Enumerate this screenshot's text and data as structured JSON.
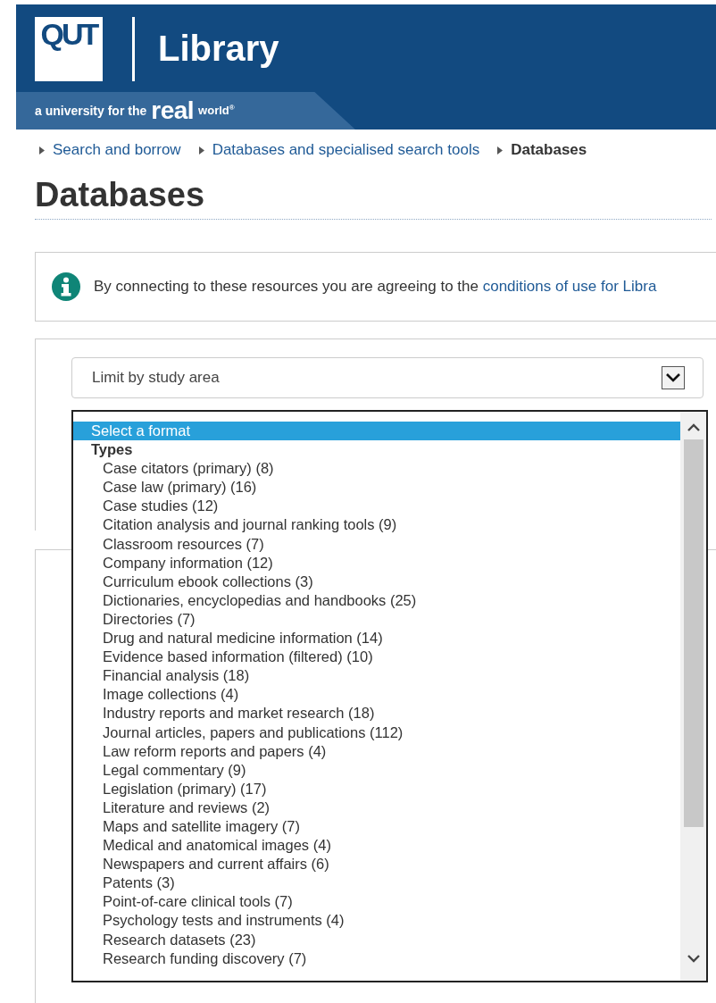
{
  "header": {
    "logo": "QUT",
    "title": "Library",
    "tagline": {
      "lead": "a university for the",
      "emphasis": "real",
      "end": "world$^{®}$"
    }
  },
  "breadcrumb": [
    {
      "label": "Search and borrow",
      "current": false
    },
    {
      "label": "Databases and specialised search tools",
      "current": false
    },
    {
      "label": "Databases",
      "current": true
    }
  ],
  "heading": "Databases",
  "notice": {
    "text": "By connecting to these resources you are agreeing to the",
    "link": "conditions of use for Libra"
  },
  "study_area": {
    "value": "Limit by study area"
  },
  "format_list": {
    "options": [
      {
        "label": "Select a format",
        "kind": "option",
        "selected": true
      },
      {
        "label": "Types",
        "kind": "group",
        "selected": false
      },
      {
        "label": "Case citators (primary) (8)",
        "kind": "suboption",
        "selected": false
      },
      {
        "label": "Case law (primary) (16)",
        "kind": "suboption",
        "selected": false
      },
      {
        "label": "Case studies (12)",
        "kind": "suboption",
        "selected": false
      },
      {
        "label": "Citation analysis and journal ranking tools (9)",
        "kind": "suboption",
        "selected": false
      },
      {
        "label": "Classroom resources (7)",
        "kind": "suboption",
        "selected": false
      },
      {
        "label": "Company information (12)",
        "kind": "suboption",
        "selected": false
      },
      {
        "label": "Curriculum ebook collections (3)",
        "kind": "suboption",
        "selected": false
      },
      {
        "label": "Dictionaries, encyclopedias and handbooks (25)",
        "kind": "suboption",
        "selected": false
      },
      {
        "label": "Directories (7)",
        "kind": "suboption",
        "selected": false
      },
      {
        "label": "Drug and natural medicine information (14)",
        "kind": "suboption",
        "selected": false
      },
      {
        "label": "Evidence based information (filtered) (10)",
        "kind": "suboption",
        "selected": false
      },
      {
        "label": "Financial analysis (18)",
        "kind": "suboption",
        "selected": false
      },
      {
        "label": "Image collections (4)",
        "kind": "suboption",
        "selected": false
      },
      {
        "label": "Industry reports and market research (18)",
        "kind": "suboption",
        "selected": false
      },
      {
        "label": "Journal articles, papers and publications (112)",
        "kind": "suboption",
        "selected": false
      },
      {
        "label": "Law reform reports and papers (4)",
        "kind": "suboption",
        "selected": false
      },
      {
        "label": "Legal commentary (9)",
        "kind": "suboption",
        "selected": false
      },
      {
        "label": "Legislation (primary) (17)",
        "kind": "suboption",
        "selected": false
      },
      {
        "label": "Literature and reviews (2)",
        "kind": "suboption",
        "selected": false
      },
      {
        "label": "Maps and satellite imagery (7)",
        "kind": "suboption",
        "selected": false
      },
      {
        "label": "Medical and anatomical images (4)",
        "kind": "suboption",
        "selected": false
      },
      {
        "label": "Newspapers and current affairs (6)",
        "kind": "suboption",
        "selected": false
      },
      {
        "label": "Patents (3)",
        "kind": "suboption",
        "selected": false
      },
      {
        "label": "Point-of-care clinical tools (7)",
        "kind": "suboption",
        "selected": false
      },
      {
        "label": "Psychology tests and instruments (4)",
        "kind": "suboption",
        "selected": false
      },
      {
        "label": "Research datasets (23)",
        "kind": "suboption",
        "selected": false
      },
      {
        "label": "Research funding discovery (7)",
        "kind": "suboption",
        "selected": false
      }
    ]
  }
}
